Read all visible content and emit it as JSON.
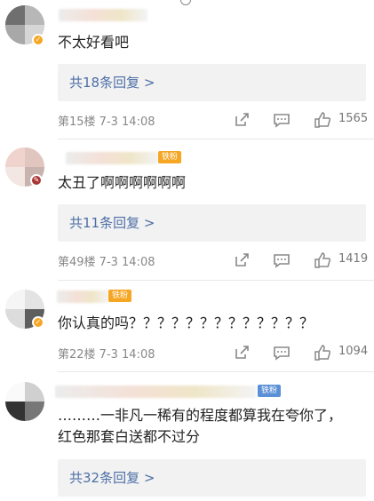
{
  "comments": [
    {
      "content": "不太好看吧",
      "replies_label": "共18条回复 >",
      "meta": "第15楼  7-3 14:08",
      "likes": "1565",
      "badge": ""
    },
    {
      "content": "太丑了啊啊啊啊啊啊",
      "replies_label": "共11条回复 >",
      "meta": "第49楼  7-3 14:08",
      "likes": "1419",
      "badge": "铁粉"
    },
    {
      "content": "你认真的吗？？？？？？？？？？？？？",
      "replies_label": "",
      "meta": "第22楼  7-3 14:08",
      "likes": "1094",
      "badge": "铁粉"
    },
    {
      "content": "………一非凡一稀有的程度都算我在夸你了，红色那套白送都不过分",
      "replies_label": "共32条回复 >",
      "meta": "",
      "likes": "",
      "badge": "铁粉"
    }
  ],
  "icons": [
    "share-icon",
    "comment-icon",
    "like-icon"
  ],
  "colors": {
    "link": "#4d6fa6",
    "badge_orange": "#f5a623",
    "badge_blue": "#5b8fd6"
  }
}
